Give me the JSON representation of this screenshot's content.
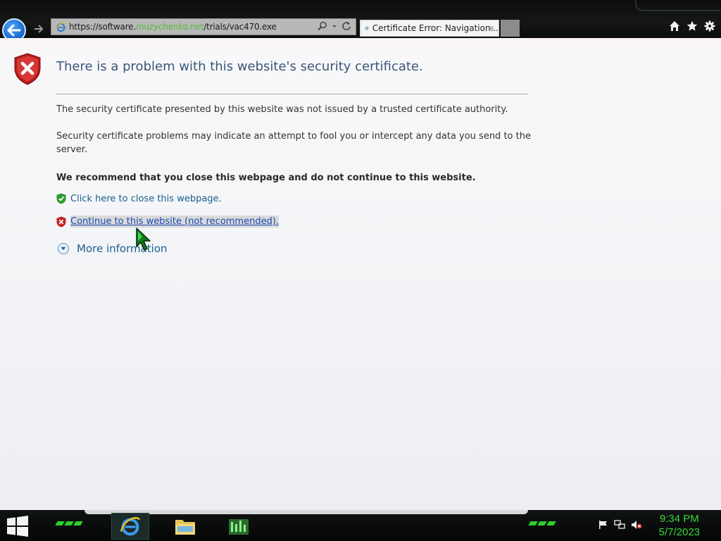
{
  "browser": {
    "url_prefix": "https://software.",
    "url_domain": "muzychenko.net",
    "url_suffix": "/trials/vac470.exe",
    "tab_title": "Certificate Error: Navigation...",
    "tab_close": "×"
  },
  "page": {
    "title": "There is a problem with this website's security certificate.",
    "para1": "The security certificate presented by this website was not issued by a trusted certificate authority.",
    "para2": "Security certificate problems may indicate an attempt to fool you or intercept any data you send to the server.",
    "recommendation": "We recommend that you close this webpage and do not continue to this website.",
    "close_link": "Click here to close this webpage.",
    "continue_link": "Continue to this website (not recommended).",
    "more_info": "More information"
  },
  "taskbar": {
    "time": "9:34 PM",
    "date": "5/7/2023"
  },
  "colors": {
    "accent_green": "#39d739",
    "link_blue": "#1a4bb3",
    "title_blue": "#3b5677"
  }
}
